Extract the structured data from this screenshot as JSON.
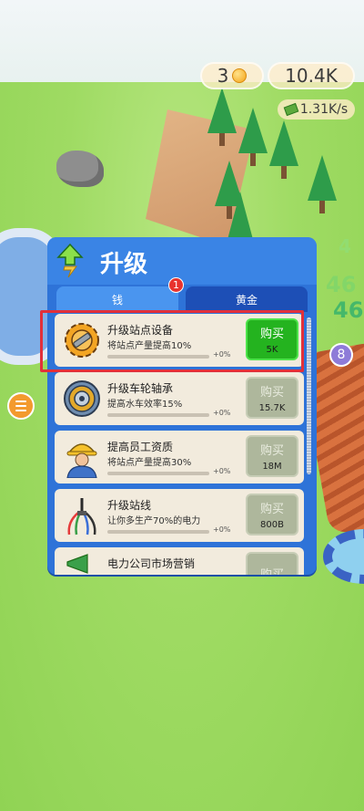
{
  "hud": {
    "gold_value": "3",
    "money_value": "10.4K",
    "rate_value": "1.31K/s"
  },
  "background": {
    "floating_numbers": [
      "46",
      "46",
      "4"
    ]
  },
  "side": {
    "badge_value": "8"
  },
  "panel": {
    "title": "升级",
    "tabs": [
      {
        "label": "钱",
        "active": true,
        "badge": "1"
      },
      {
        "label": "黄金",
        "active": false
      }
    ],
    "items": [
      {
        "title": "升级站点设备",
        "desc": "将站点产量提高10%",
        "pct": "+0%",
        "buy_label": "购买",
        "cost": "5K",
        "affordable": true,
        "icon": "gear-wrench-icon"
      },
      {
        "title": "升级车轮轴承",
        "desc": "提高水车效率15%",
        "pct": "+0%",
        "buy_label": "购买",
        "cost": "15.7K",
        "affordable": false,
        "icon": "bearing-icon"
      },
      {
        "title": "提高员工资质",
        "desc": "将站点产量提高30%",
        "pct": "+0%",
        "buy_label": "购买",
        "cost": "18M",
        "affordable": false,
        "icon": "worker-icon"
      },
      {
        "title": "升级站线",
        "desc": "让你多生产70%的电力",
        "pct": "+0%",
        "buy_label": "购买",
        "cost": "800B",
        "affordable": false,
        "icon": "cable-icon"
      },
      {
        "title": "电力公司市场营销",
        "buy_label": "购买",
        "affordable": false,
        "icon": "marketing-icon"
      }
    ]
  },
  "colors": {
    "panel": "#2e73d8",
    "buy_active": "#24b31f",
    "buy_inactive": "#aeb79c",
    "highlight": "#e2303a"
  }
}
